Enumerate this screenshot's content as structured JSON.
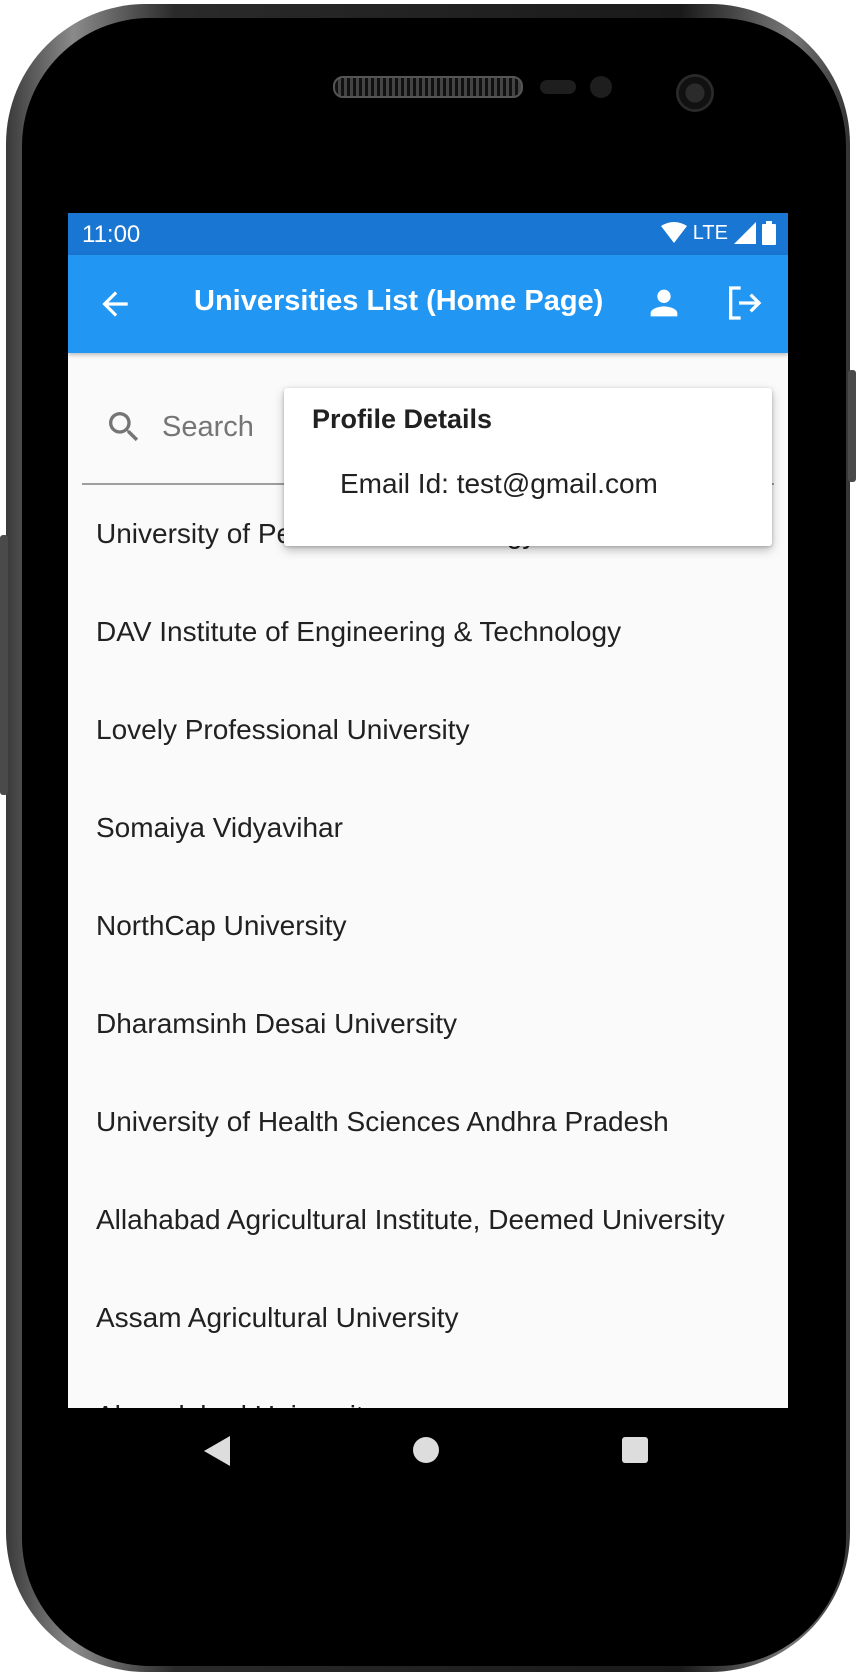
{
  "status_bar": {
    "time": "11:00",
    "network": "LTE"
  },
  "app_bar": {
    "title": "Universities List (Home Page)"
  },
  "search": {
    "placeholder": "Search",
    "value": ""
  },
  "universities": [
    "University of Petroleum and Energy Studies",
    "DAV Institute of Engineering & Technology",
    "Lovely Professional University",
    "Somaiya Vidyavihar",
    "NorthCap University",
    "Dharamsinh Desai University",
    "University of Health Sciences Andhra Pradesh",
    "Allahabad Agricultural Institute, Deemed University",
    "Assam Agricultural University",
    "Ahmedabad University"
  ],
  "profile_popup": {
    "title": "Profile Details",
    "email": "Email Id: test@gmail.com"
  },
  "colors": {
    "status_bar": "#1976d2",
    "app_bar": "#2196f3",
    "background": "#fafafa"
  }
}
